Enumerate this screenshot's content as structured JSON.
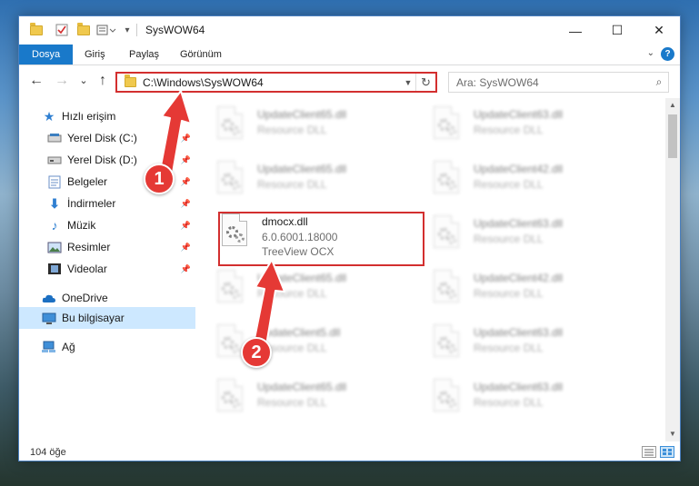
{
  "window": {
    "title": "SysWOW64",
    "controls": {
      "minimize": "—",
      "maximize": "☐",
      "close": "✕"
    }
  },
  "ribbon": {
    "tabs": [
      "Dosya",
      "Giriş",
      "Paylaş",
      "Görünüm"
    ],
    "help": "?"
  },
  "nav": {
    "back": "←",
    "forward": "→",
    "recent": "⌄",
    "up": "↑",
    "address": "C:\\Windows\\SysWOW64",
    "refresh": "↻",
    "search_placeholder": "Ara: SysWOW64"
  },
  "sidebar": {
    "items": [
      {
        "label": "Hızlı erişim",
        "icon": "star-icon",
        "pinned": false
      },
      {
        "label": "Yerel Disk (C:)",
        "icon": "drive-icon",
        "pinned": true
      },
      {
        "label": "Yerel Disk (D:)",
        "icon": "drive-icon",
        "pinned": true
      },
      {
        "label": "Belgeler",
        "icon": "documents-icon",
        "pinned": true
      },
      {
        "label": "İndirmeler",
        "icon": "download-icon",
        "pinned": true
      },
      {
        "label": "Müzik",
        "icon": "music-icon",
        "pinned": true
      },
      {
        "label": "Resimler",
        "icon": "pictures-icon",
        "pinned": true
      },
      {
        "label": "Videolar",
        "icon": "videos-icon",
        "pinned": true
      },
      {
        "label": "OneDrive",
        "icon": "cloud-icon",
        "pinned": false
      },
      {
        "label": "Bu bilgisayar",
        "icon": "computer-icon",
        "pinned": false,
        "selected": true
      },
      {
        "label": "Ağ",
        "icon": "network-icon",
        "pinned": false
      }
    ]
  },
  "files": {
    "left": [
      {
        "name": "UpdateClient65.dll",
        "type": "Resource DLL"
      },
      {
        "name": "UpdateClient65.dll",
        "type": "Resource DLL"
      },
      {
        "name": "dmocx.dll",
        "version": "6.0.6001.18000",
        "type": "TreeView OCX",
        "highlighted": true
      },
      {
        "name": "UpdateClient65.dll",
        "type": "Resource DLL"
      },
      {
        "name": "UpdateClient5.dll",
        "type": "Resource DLL"
      },
      {
        "name": "UpdateClient65.dll",
        "type": "Resource DLL"
      }
    ],
    "right": [
      {
        "name": "UpdateClient63.dll",
        "type": "Resource DLL"
      },
      {
        "name": "UpdateClient42.dll",
        "type": "Resource DLL"
      },
      {
        "name": "UpdateClient63.dll",
        "type": "Resource DLL"
      },
      {
        "name": "UpdateClient42.dll",
        "type": "Resource DLL"
      },
      {
        "name": "UpdateClient63.dll",
        "type": "Resource DLL"
      },
      {
        "name": "UpdateClient63.dll",
        "type": "Resource DLL"
      }
    ]
  },
  "status": {
    "count": "104 öğe"
  },
  "annotations": {
    "step1": "1",
    "step2": "2",
    "color": "#e53935"
  }
}
